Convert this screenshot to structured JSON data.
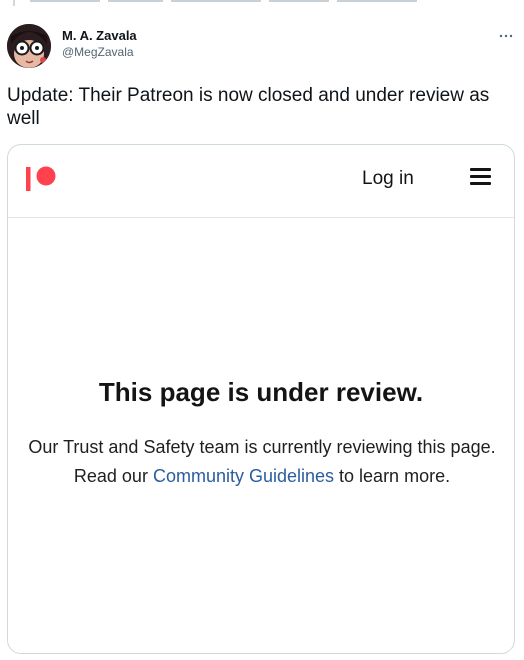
{
  "tweet": {
    "author": {
      "display_name": "M. A. Zavala",
      "handle": "@MegZavala"
    },
    "more_icon": "more-horizontal-icon",
    "text": "Update: Their Patreon is now closed and under review as well"
  },
  "card": {
    "nav": {
      "logo_icon": "patreon-logo-icon",
      "login_label": "Log in",
      "menu_icon": "hamburger-menu-icon"
    },
    "review": {
      "title": "This page is under review.",
      "line1": "Our Trust and Safety team is currently reviewing this page.",
      "line2_prefix": "Read our ",
      "link_text": "Community Guidelines",
      "line2_suffix": " to learn more."
    }
  },
  "colors": {
    "patreon_brand": "#ff424d",
    "link": "#2a5d9f",
    "border": "#cfd9de",
    "secondary_text": "#536471"
  }
}
